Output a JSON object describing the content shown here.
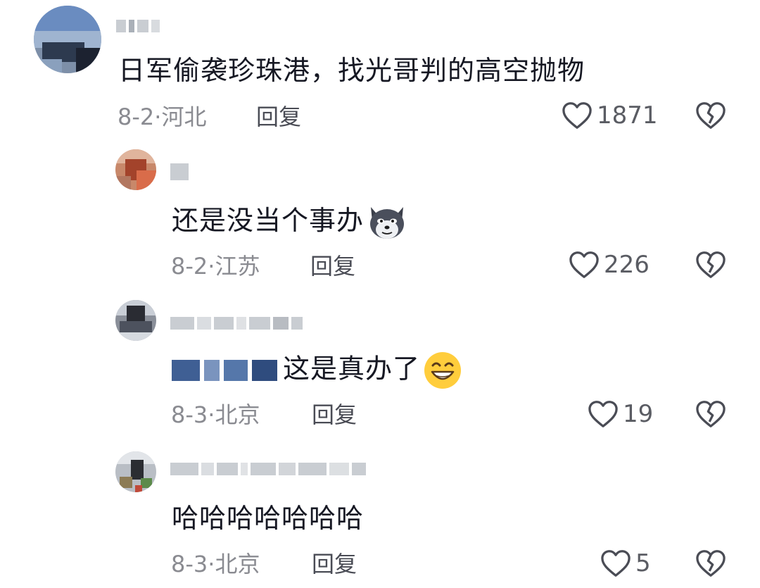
{
  "comments": [
    {
      "text": "日军偷袭珍珠港，找光哥判的高空抛物",
      "date": "8-2",
      "location": "河北",
      "reply_label": "回复",
      "likes": "1871"
    },
    {
      "text": "还是没当个事办",
      "emoji": "husky-dog-emoji",
      "date": "8-2",
      "location": "江苏",
      "reply_label": "回复",
      "likes": "226"
    },
    {
      "text": "这是真办了",
      "emoji": "grinning-face-emoji",
      "date": "8-3",
      "location": "北京",
      "reply_label": "回复",
      "likes": "19"
    },
    {
      "text": "哈哈哈哈哈哈哈",
      "date": "8-3",
      "location": "北京",
      "reply_label": "回复",
      "likes": "5"
    }
  ],
  "colors": {
    "text": "#161823",
    "meta": "#8a8b91",
    "icon": "#4a4c55",
    "blur": "#c9cdd2"
  }
}
